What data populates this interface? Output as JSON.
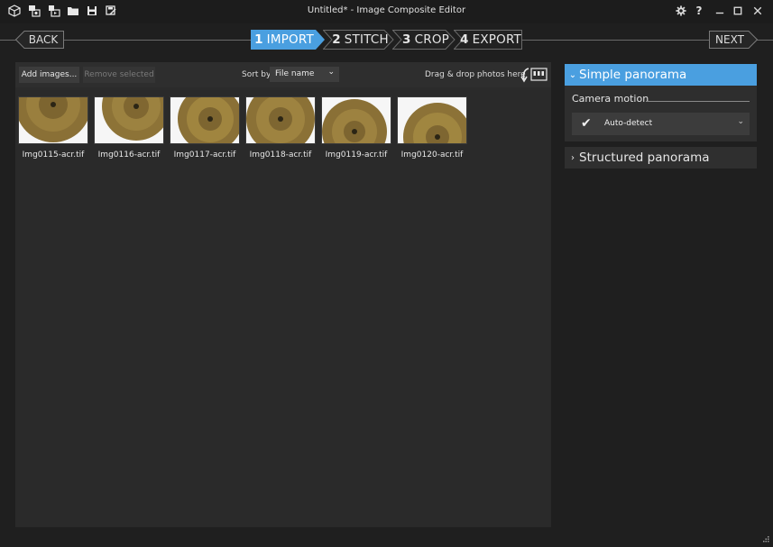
{
  "window": {
    "title": "Untitled* - Image Composite Editor",
    "toolbar_icons": [
      "new-project-icon",
      "new-panorama-icon",
      "new-video-panorama-icon",
      "open-folder-icon",
      "save-icon",
      "save-as-icon"
    ],
    "right_icons": [
      "settings-icon",
      "help-icon",
      "minimize-icon",
      "maximize-icon",
      "close-icon"
    ],
    "help_glyph": "?"
  },
  "nav": {
    "back_label": "BACK",
    "next_label": "NEXT",
    "steps": [
      {
        "num": "1",
        "label": "IMPORT",
        "active": true
      },
      {
        "num": "2",
        "label": "STITCH",
        "active": false
      },
      {
        "num": "3",
        "label": "CROP",
        "active": false
      },
      {
        "num": "4",
        "label": "EXPORT",
        "active": false
      }
    ]
  },
  "import": {
    "add_label": "Add images...",
    "remove_label": "Remove selected",
    "sort_label": "Sort by",
    "sort_value": "File name",
    "drag_label": "Drag & drop photos here",
    "images": [
      {
        "name": "Img0115-acr.tif"
      },
      {
        "name": "Img0116-acr.tif"
      },
      {
        "name": "Img0117-acr.tif"
      },
      {
        "name": "Img0118-acr.tif"
      },
      {
        "name": "Img0119-acr.tif"
      },
      {
        "name": "Img0120-acr.tif"
      }
    ]
  },
  "options": {
    "simple_title": "Simple panorama",
    "camera_motion_label": "Camera motion",
    "camera_motion_value": "Auto-detect",
    "structured_title": "Structured panorama"
  },
  "colors": {
    "accent": "#4a9fe0",
    "background": "#1f1f1f",
    "panel": "#2b2b2b"
  }
}
